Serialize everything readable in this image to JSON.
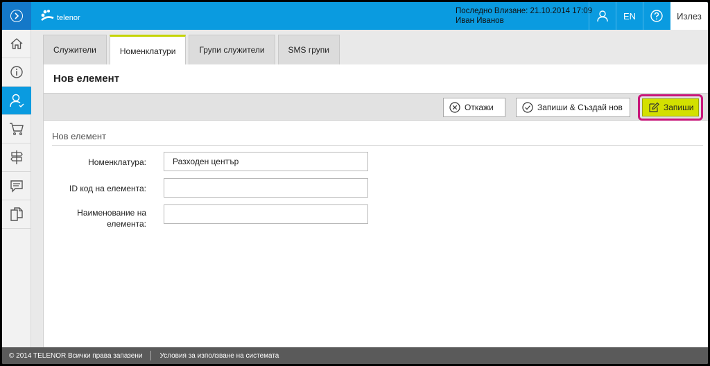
{
  "header": {
    "brand": "telenor",
    "last_login_label": "Последно Влизане: 21.10.2014 17:09",
    "user_name": "Иван Иванов",
    "lang": "EN",
    "logout": "Излез"
  },
  "tabs": [
    {
      "label": "Служители"
    },
    {
      "label": "Номенклатури"
    },
    {
      "label": "Групи служители"
    },
    {
      "label": "SMS групи"
    }
  ],
  "page": {
    "title": "Нов елемент",
    "section_title": "Нов елемент"
  },
  "actions": {
    "cancel": "Откажи",
    "save_new": "Запиши & Създай нов",
    "save": "Запиши"
  },
  "form": {
    "nomenclature_label": "Номенклатура:",
    "nomenclature_value": "Разходен център",
    "id_label": "ID код на елемента:",
    "id_value": "",
    "name_label_1": "Наименование на",
    "name_label_2": "елемента:",
    "name_value": ""
  },
  "footer": {
    "copyright": "© 2014 TELENOR Всички права запазени",
    "terms": "Условия за използване на системата"
  },
  "colors": {
    "topbar": "#0a9be0",
    "accent": "#d3e000",
    "highlight": "#c8167a"
  }
}
